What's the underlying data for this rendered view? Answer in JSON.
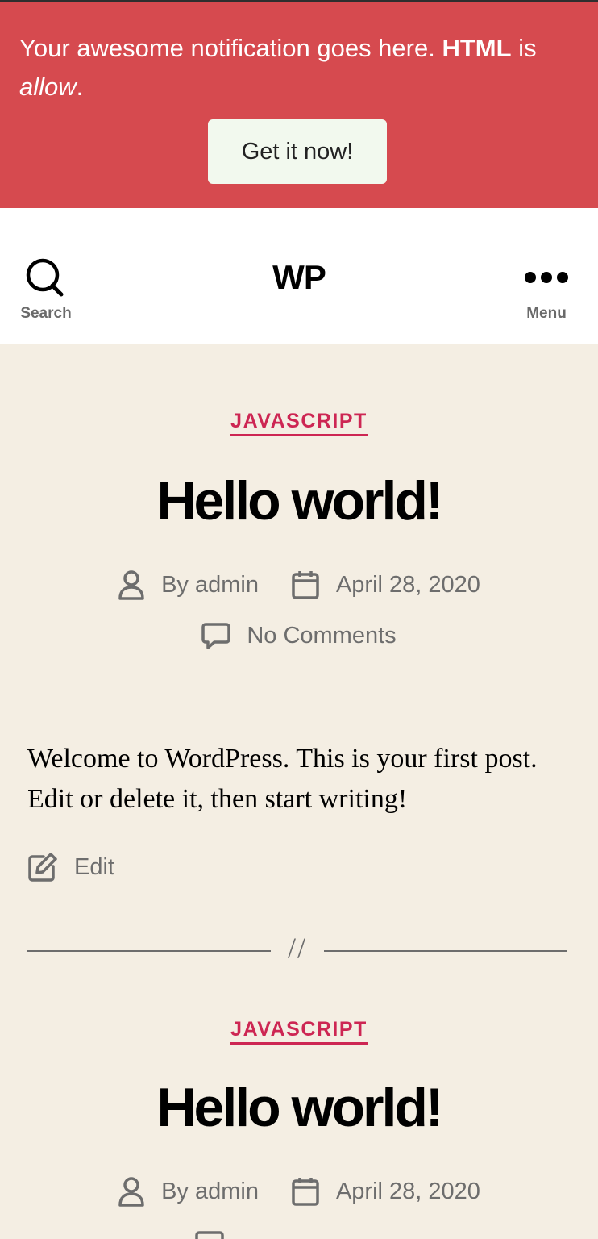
{
  "notification": {
    "text_plain": "Your awesome notification goes here. ",
    "text_bold": "HTML",
    "text_mid": " is ",
    "text_italic": "allow",
    "text_end": ".",
    "button_label": "Get it now!",
    "background": "#d64a4f"
  },
  "header": {
    "search_label": "Search",
    "site_title": "WP",
    "menu_label": "Menu",
    "search_icon": "search-icon",
    "menu_icon": "ellipsis-icon"
  },
  "posts": [
    {
      "category": "JAVASCRIPT",
      "title": "Hello world!",
      "author": "By admin",
      "date": "April 28, 2020",
      "comments": "No Comments",
      "excerpt": "Welcome to WordPress. This is your first post. Edit or delete it, then start writing!",
      "edit_label": "Edit"
    },
    {
      "category": "JAVASCRIPT",
      "title": "Hello world!",
      "author": "By admin",
      "date": "April 28, 2020"
    }
  ],
  "separator": "//",
  "colors": {
    "accent": "#cd2653",
    "page_bg": "#f4eee3",
    "meta_text": "#6d6d6d"
  }
}
